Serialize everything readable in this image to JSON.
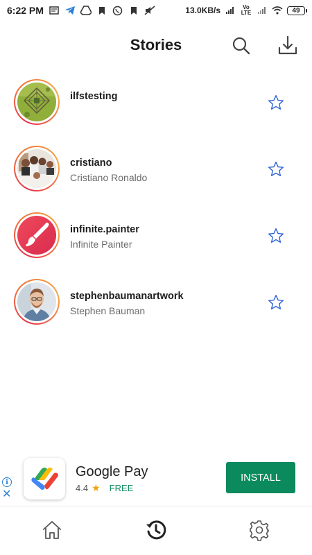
{
  "status_bar": {
    "time": "6:22 PM",
    "net_speed": "13.0KB/s",
    "carrier": "Vo LTE",
    "battery": "49",
    "icons": [
      "message-icon",
      "telegram-icon",
      "drive-icon",
      "bookmark-icon",
      "whatsapp-icon",
      "bookmark-icon",
      "muted-icon"
    ]
  },
  "header": {
    "title": "Stories",
    "icons": [
      "search-icon",
      "download-icon"
    ]
  },
  "stories": [
    {
      "username": "ilfstesting",
      "full_name": "",
      "avatar": "aerial-field-image"
    },
    {
      "username": "cristiano",
      "full_name": "Cristiano Ronaldo",
      "avatar": "family-photo"
    },
    {
      "username": "infinite.painter",
      "full_name": "Infinite Painter",
      "avatar": "brush-logo"
    },
    {
      "username": "stephenbaumanartwork",
      "full_name": "Stephen Bauman",
      "avatar": "portrait-photo"
    }
  ],
  "ad": {
    "title": "Google Pay",
    "rating": "4.4",
    "price": "FREE",
    "install_label": "INSTALL",
    "info_glyph": "i",
    "close_glyph": "✕"
  },
  "bottom_nav": {
    "items": [
      "home-icon",
      "history-icon",
      "settings-icon"
    ]
  },
  "colors": {
    "ring_start": "#e8344a",
    "ring_end": "#f5a94b",
    "star_outline": "#2f63d8",
    "install_bg": "#0b8a5e",
    "ad_accent": "#2a7fd4"
  }
}
